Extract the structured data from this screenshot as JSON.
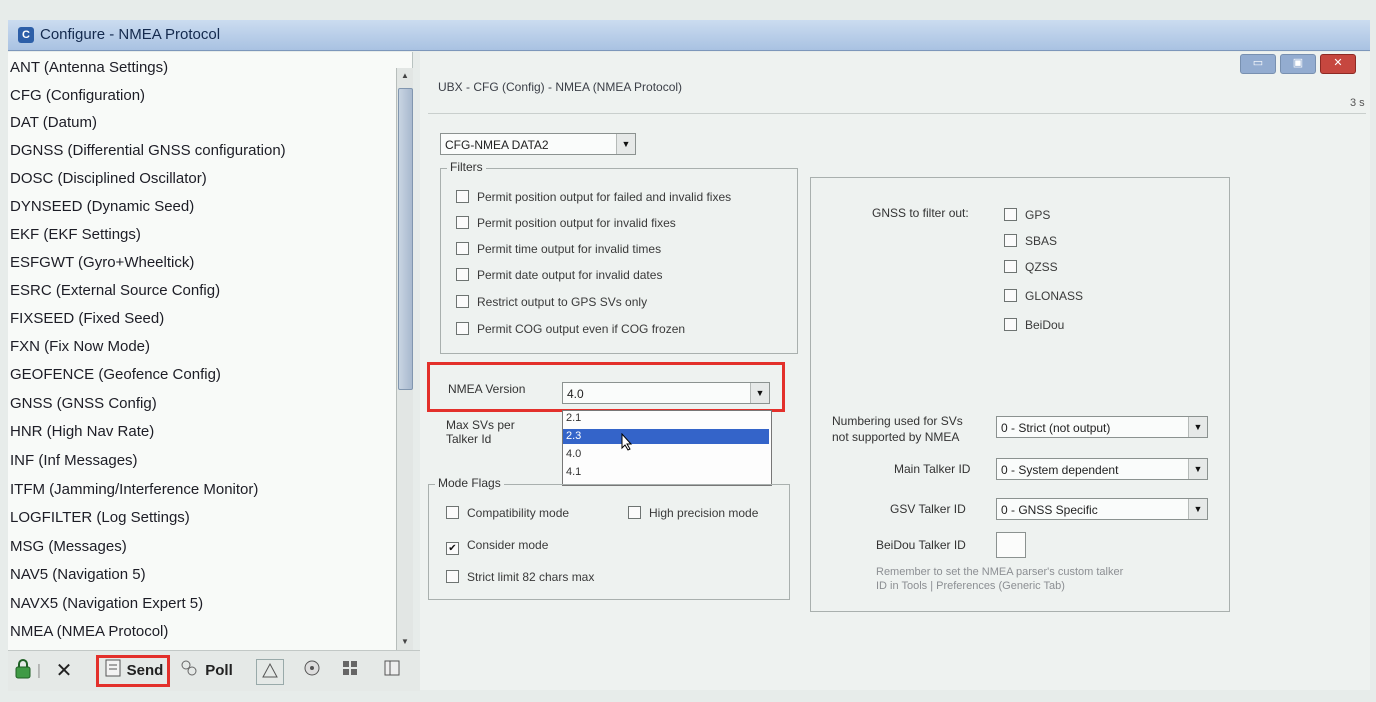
{
  "window": {
    "title": "Configure - NMEA Protocol",
    "icon": "app-icon",
    "icon_glyph": "C"
  },
  "tree": {
    "items": [
      "ANT (Antenna Settings)",
      "CFG (Configuration)",
      "DAT (Datum)",
      "DGNSS (Differential GNSS configuration)",
      "DOSC (Disciplined Oscillator)",
      "DYNSEED (Dynamic Seed)",
      "EKF (EKF Settings)",
      "ESFGWT (Gyro+Wheeltick)",
      "ESRC (External Source Config)",
      "FIXSEED (Fixed Seed)",
      "FXN (Fix Now Mode)",
      "GEOFENCE (Geofence Config)",
      "GNSS (GNSS Config)",
      "HNR (High Nav Rate)",
      "INF (Inf Messages)",
      "ITFM (Jamming/Interference Monitor)",
      "LOGFILTER (Log Settings)",
      "MSG (Messages)",
      "NAV5 (Navigation 5)",
      "NAVX5 (Navigation Expert 5)",
      "NMEA (NMEA Protocol)"
    ],
    "selected": "NMEA (NMEA Protocol)"
  },
  "toolbar": {
    "send_label": "Send",
    "poll_label": "Poll"
  },
  "header": {
    "breadcrumb": "UBX - CFG (Config) - NMEA (NMEA Protocol)",
    "page_indicator": "3 s"
  },
  "form": {
    "message_select": "CFG-NMEA DATA2",
    "filters": {
      "title": "Filters",
      "options": [
        {
          "label": "Permit position output for failed and invalid fixes",
          "checked": false
        },
        {
          "label": "Permit position output for invalid fixes",
          "checked": false
        },
        {
          "label": "Permit time output for invalid times",
          "checked": false
        },
        {
          "label": "Permit date output for invalid dates",
          "checked": false
        },
        {
          "label": "Restrict output to GPS SVs only",
          "checked": false
        },
        {
          "label": "Permit COG output even if COG frozen",
          "checked": false
        }
      ]
    },
    "nmea_version": {
      "label": "NMEA Version",
      "value": "4.0",
      "options": [
        "2.1",
        "2.3",
        "4.0",
        "4.1"
      ],
      "highlighted": "2.3"
    },
    "max_svs": {
      "label_line1": "Max SVs per",
      "label_line2": "Talker Id"
    },
    "mode_flags": {
      "title": "Mode Flags",
      "compat_label": "Compatibility mode",
      "compat_checked": false,
      "highprec_label": "High precision mode",
      "highprec_checked": false,
      "consider_label": "Consider mode",
      "consider_checked": true,
      "strict_label": "Strict limit 82 chars max",
      "strict_checked": false
    },
    "gnss_filter": {
      "label": "GNSS to filter out:",
      "options": [
        "GPS",
        "SBAS",
        "QZSS",
        "GLONASS",
        "BeiDou"
      ]
    },
    "numbering": {
      "label_line1": "Numbering used for SVs",
      "label_line2": "not supported by NMEA",
      "value": "0 - Strict (not output)"
    },
    "main_talker": {
      "label": "Main Talker ID",
      "value": "0 - System dependent"
    },
    "gsv_talker": {
      "label": "GSV Talker ID",
      "value": "0 - GNSS Specific"
    },
    "beidou_talker": {
      "label": "BeiDou Talker ID",
      "value": ""
    },
    "note_line1": "Remember to set the NMEA parser's custom talker",
    "note_line2": "ID in Tools | Preferences (Generic Tab)"
  },
  "colors": {
    "highlight_box": "#e3302b",
    "selection": "#3464c9",
    "titlebar": "#a9c2e2"
  }
}
